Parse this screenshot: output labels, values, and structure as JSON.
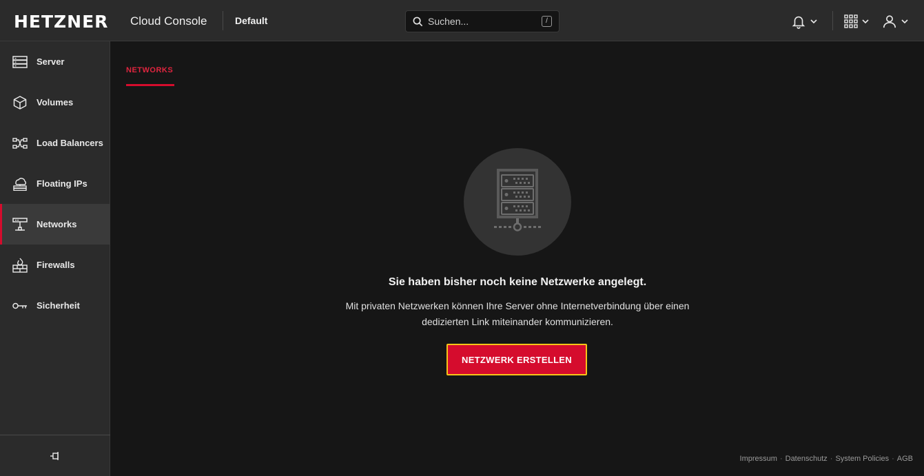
{
  "header": {
    "logo": "HETZNER",
    "app_title": "Cloud Console",
    "project": "Default",
    "search_placeholder": "Suchen...",
    "search_shortcut": "/"
  },
  "sidebar": {
    "items": [
      {
        "label": "Server",
        "icon": "server-icon"
      },
      {
        "label": "Volumes",
        "icon": "cube-icon"
      },
      {
        "label": "Load Balancers",
        "icon": "load-balancer-icon"
      },
      {
        "label": "Floating IPs",
        "icon": "floating-ip-icon"
      },
      {
        "label": "Networks",
        "icon": "network-icon",
        "active": true
      },
      {
        "label": "Firewalls",
        "icon": "firewall-icon"
      },
      {
        "label": "Sicherheit",
        "icon": "key-icon"
      }
    ],
    "pin_icon": "pin-icon"
  },
  "main": {
    "tab": "NETWORKS",
    "empty_title": "Sie haben bisher noch keine Netzwerke angelegt.",
    "empty_description": "Mit privaten Netzwerken können Ihre Server ohne Internetverbindung über einen dedizierten Link miteinander kommunizieren.",
    "cta_label": "NETZWERK ERSTELLEN"
  },
  "footer": {
    "links": [
      "Impressum",
      "Datenschutz",
      "System Policies",
      "AGB"
    ]
  },
  "colors": {
    "accent": "#d50c2d",
    "focus_ring": "#f5c518",
    "topbar": "#2b2b2b",
    "background": "#161616"
  }
}
